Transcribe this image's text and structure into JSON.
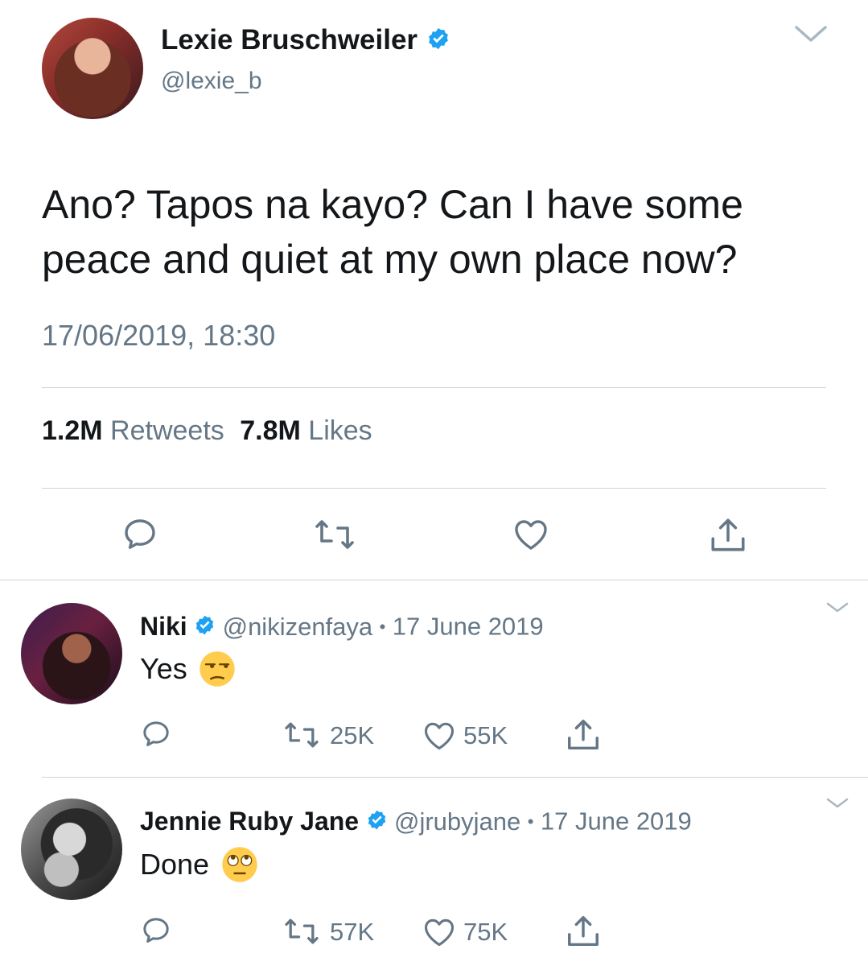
{
  "main_tweet": {
    "author": {
      "name": "Lexie Bruschweiler",
      "handle": "@lexie_b",
      "verified": true
    },
    "text_line1": "Ano? Tapos na kayo? Can I have some",
    "text_line2": "peace and quiet at my own place now?",
    "timestamp": "17/06/2019, 18:30",
    "retweets_count": "1.2M",
    "retweets_label": "Retweets",
    "likes_count": "7.8M",
    "likes_label": "Likes",
    "actions": [
      "reply-icon",
      "retweet-icon",
      "like-icon",
      "share-icon"
    ]
  },
  "replies": [
    {
      "name": "Niki",
      "verified": true,
      "handle": "@nikizenfaya",
      "separator": "•",
      "date": "17 June 2019",
      "text": "Yes",
      "emoji": "unamused-face",
      "retweets": "25K",
      "likes": "55K"
    },
    {
      "name": "Jennie Ruby Jane",
      "verified": true,
      "handle": "@jrubyjane",
      "separator": "•",
      "date": "17 June 2019",
      "text": "Done",
      "emoji": "eye-roll-face",
      "retweets": "57K",
      "likes": "75K"
    }
  ],
  "colors": {
    "verified_blue": "#1da1f2",
    "secondary_text": "#657786",
    "divider": "#ccd6dd",
    "icon": "#657786",
    "emoji_yellow": "#ffcc4d"
  }
}
